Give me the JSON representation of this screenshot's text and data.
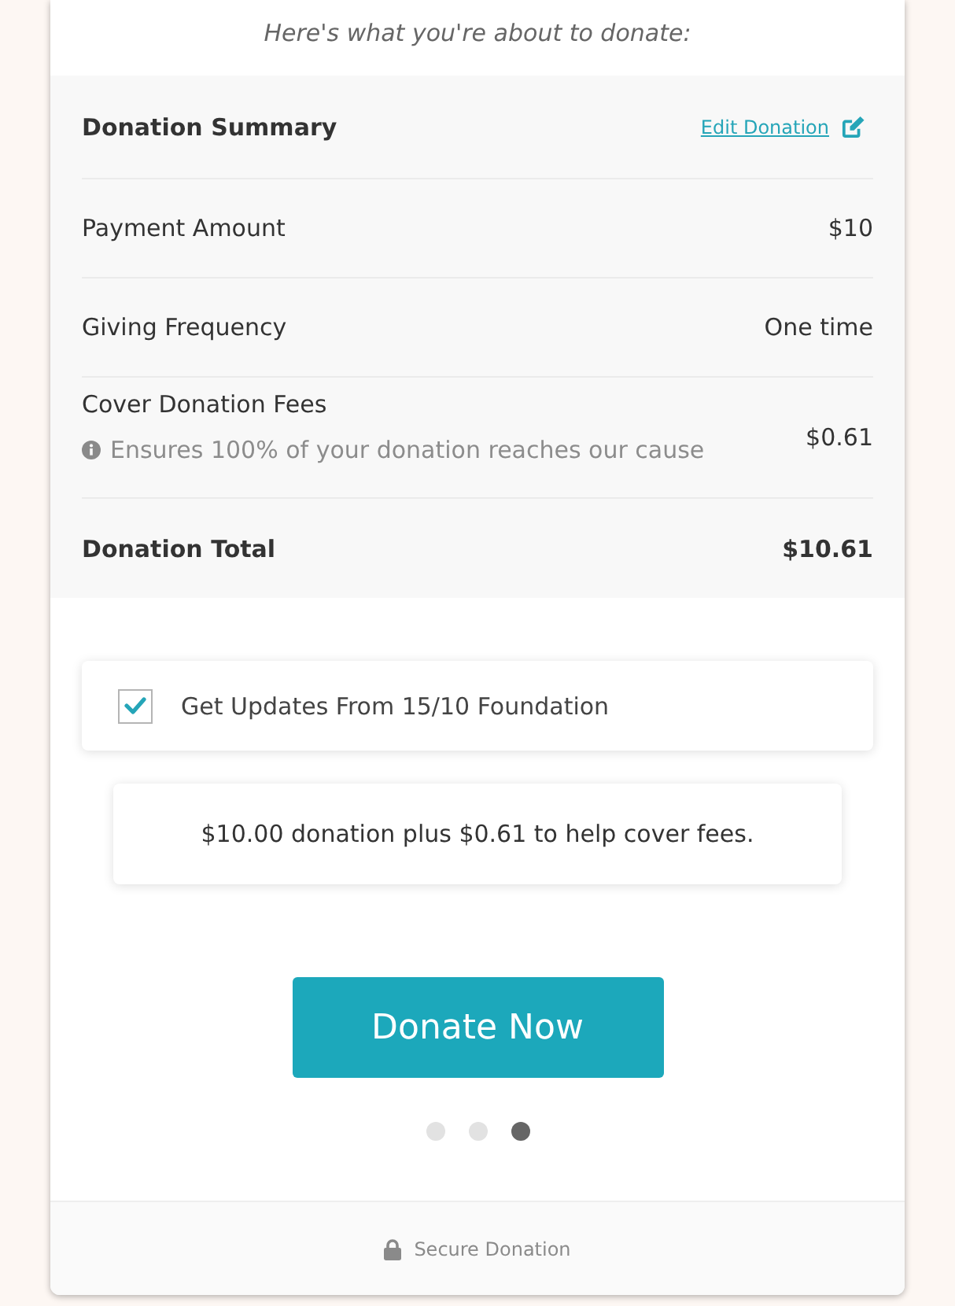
{
  "intro": "Here's what you're about to donate:",
  "summary": {
    "title": "Donation Summary",
    "edit_link": "Edit Donation",
    "rows": [
      {
        "kind": "line",
        "label": "Payment Amount",
        "value": "$10"
      },
      {
        "kind": "line",
        "label": "Giving Frequency",
        "value": "One time"
      },
      {
        "kind": "note",
        "label": "Cover Donation Fees",
        "note": "Ensures 100% of your donation reaches our cause",
        "value": "$0.61"
      },
      {
        "kind": "total",
        "label": "Donation Total",
        "value": "$10.61"
      }
    ]
  },
  "updates_option": {
    "label": "Get Updates From 15/10 Foundation",
    "checked": true
  },
  "fee_note": "$10.00 donation plus $0.61 to help cover fees.",
  "donate_button": "Donate Now",
  "steps": [
    {
      "selected": false
    },
    {
      "selected": false
    },
    {
      "selected": true
    }
  ],
  "footer": "Secure Donation"
}
